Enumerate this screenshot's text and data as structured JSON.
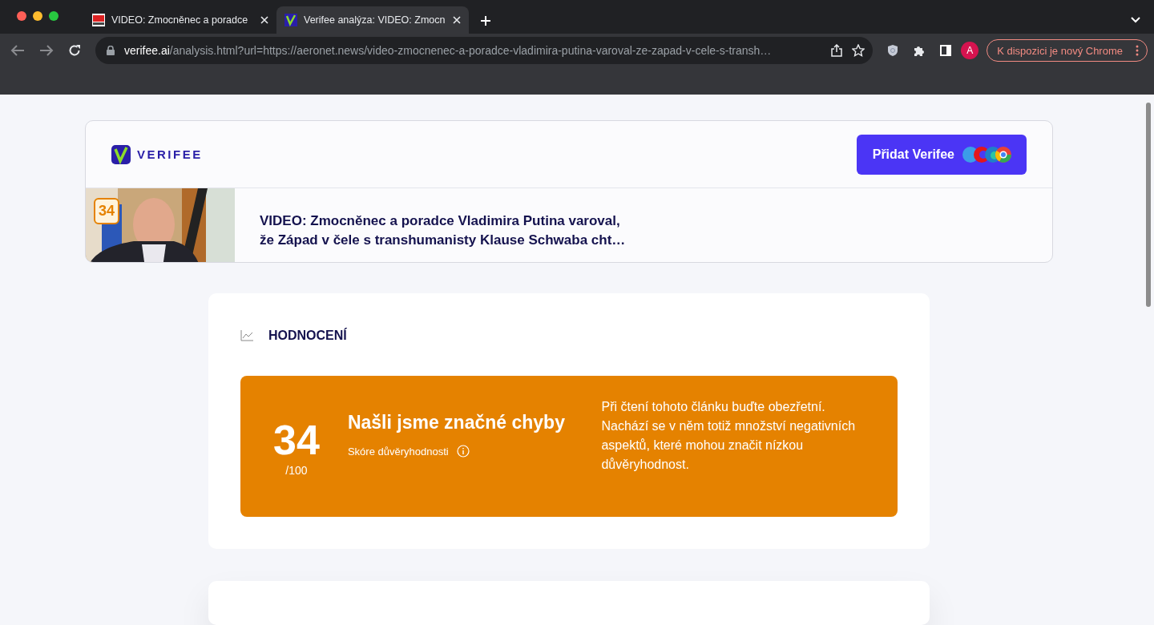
{
  "browser": {
    "tabs": [
      {
        "title": "VIDEO: Zmocněnec a poradce",
        "selected": false
      },
      {
        "title": "Verifee analýza: VIDEO: Zmocn",
        "selected": true
      }
    ],
    "address": {
      "host": "verifee.ai",
      "path": "/analysis.html?url=https://aeronet.news/video-zmocnenec-a-poradce-vladimira-putina-varoval-ze-zapad-v-cele-s-transh…"
    },
    "profile": "A",
    "update_button": "K dispozici je nový Chrome"
  },
  "header": {
    "logo": "VERIFEE",
    "add_button": "Přidat Verifee"
  },
  "article": {
    "score_badge": "34",
    "title": "VIDEO: Zmocněnec a poradce Vladimira Putina varoval,\nže Západ v čele s transhumanisty Klause Schwaba cht…"
  },
  "rating": {
    "heading": "HODNOCENÍ",
    "score": "34",
    "max": "/100",
    "verdict": "Našli jsme značné chyby",
    "score_label": "Skóre důvěryhodnosti",
    "description": "Při čtení tohoto článku buďte obezřetní. Nachází se v něm totiž množství negativních aspektů, které mohou značit nízkou důvěryhodnost.",
    "color": "#e58200"
  }
}
